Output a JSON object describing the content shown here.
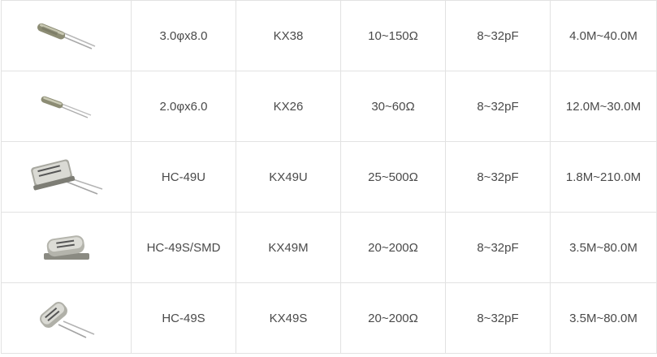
{
  "rows": [
    {
      "image": "cylindrical-crystal-3x8-icon",
      "size": "3.0φx8.0",
      "model": "KX38",
      "resistance": "10~150Ω",
      "capacitance": "8~32pF",
      "frequency": "4.0M~40.0M"
    },
    {
      "image": "cylindrical-crystal-2x6-icon",
      "size": "2.0φx6.0",
      "model": "KX26",
      "resistance": "30~60Ω",
      "capacitance": "8~32pF",
      "frequency": "12.0M~30.0M"
    },
    {
      "image": "hc49u-crystal-icon",
      "size": "HC-49U",
      "model": "KX49U",
      "resistance": "25~500Ω",
      "capacitance": "8~32pF",
      "frequency": "1.8M~210.0M"
    },
    {
      "image": "hc49s-smd-crystal-icon",
      "size": "HC-49S/SMD",
      "model": "KX49M",
      "resistance": "20~200Ω",
      "capacitance": "8~32pF",
      "frequency": "3.5M~80.0M"
    },
    {
      "image": "hc49s-crystal-icon",
      "size": "HC-49S",
      "model": "KX49S",
      "resistance": "20~200Ω",
      "capacitance": "8~32pF",
      "frequency": "3.5M~80.0M"
    }
  ]
}
